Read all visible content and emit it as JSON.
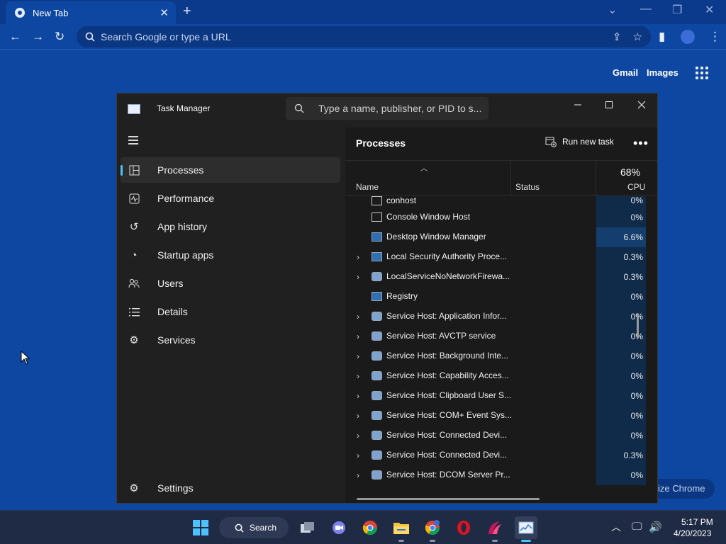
{
  "chrome": {
    "tab_title": "New Tab",
    "omnibox_placeholder": "Search Google or type a URL",
    "ntp_links": {
      "gmail": "Gmail",
      "images": "Images"
    },
    "customize_button": "ize Chrome"
  },
  "task_manager": {
    "title": "Task Manager",
    "search_placeholder": "Type a name, publisher, or PID to s...",
    "nav": [
      {
        "label": "Processes",
        "icon": "processes-icon",
        "active": true
      },
      {
        "label": "Performance",
        "icon": "performance-icon"
      },
      {
        "label": "App history",
        "icon": "app-history-icon"
      },
      {
        "label": "Startup apps",
        "icon": "startup-apps-icon"
      },
      {
        "label": "Users",
        "icon": "users-icon"
      },
      {
        "label": "Details",
        "icon": "details-icon"
      },
      {
        "label": "Services",
        "icon": "services-icon"
      }
    ],
    "settings_label": "Settings",
    "page_title": "Processes",
    "run_new_task": "Run new task",
    "columns": {
      "name": "Name",
      "status": "Status",
      "cpu_total": "68%",
      "cpu": "CPU"
    },
    "processes": [
      {
        "name": "conhost",
        "cpu": "0%",
        "expandable": false,
        "icon": "console"
      },
      {
        "name": "Console Window Host",
        "cpu": "0%",
        "expandable": false,
        "icon": "console"
      },
      {
        "name": "Desktop Window Manager",
        "cpu": "6.6%",
        "expandable": false,
        "icon": "window"
      },
      {
        "name": "Local Security Authority Proce...",
        "cpu": "0.3%",
        "expandable": true,
        "icon": "window"
      },
      {
        "name": "LocalServiceNoNetworkFirewa...",
        "cpu": "0.3%",
        "expandable": true,
        "icon": "gear"
      },
      {
        "name": "Registry",
        "cpu": "0%",
        "expandable": false,
        "icon": "window"
      },
      {
        "name": "Service Host: Application Infor...",
        "cpu": "0%",
        "expandable": true,
        "icon": "gear"
      },
      {
        "name": "Service Host: AVCTP service",
        "cpu": "0%",
        "expandable": true,
        "icon": "gear"
      },
      {
        "name": "Service Host: Background Inte...",
        "cpu": "0%",
        "expandable": true,
        "icon": "gear"
      },
      {
        "name": "Service Host: Capability Acces...",
        "cpu": "0%",
        "expandable": true,
        "icon": "gear"
      },
      {
        "name": "Service Host: Clipboard User S...",
        "cpu": "0%",
        "expandable": true,
        "icon": "gear"
      },
      {
        "name": "Service Host: COM+ Event Sys...",
        "cpu": "0%",
        "expandable": true,
        "icon": "gear"
      },
      {
        "name": "Service Host: Connected Devi...",
        "cpu": "0%",
        "expandable": true,
        "icon": "gear"
      },
      {
        "name": "Service Host: Connected Devi...",
        "cpu": "0.3%",
        "expandable": true,
        "icon": "gear"
      },
      {
        "name": "Service Host: DCOM Server Pr...",
        "cpu": "0%",
        "expandable": true,
        "icon": "gear"
      }
    ]
  },
  "taskbar": {
    "search_label": "Search",
    "time": "5:17 PM",
    "date": "4/20/2023"
  },
  "colors": {
    "accent": "#4cc2ff",
    "chrome_background": "#0d47a1",
    "task_manager_background": "#202020",
    "cpu_highlight": "#133e6e"
  }
}
